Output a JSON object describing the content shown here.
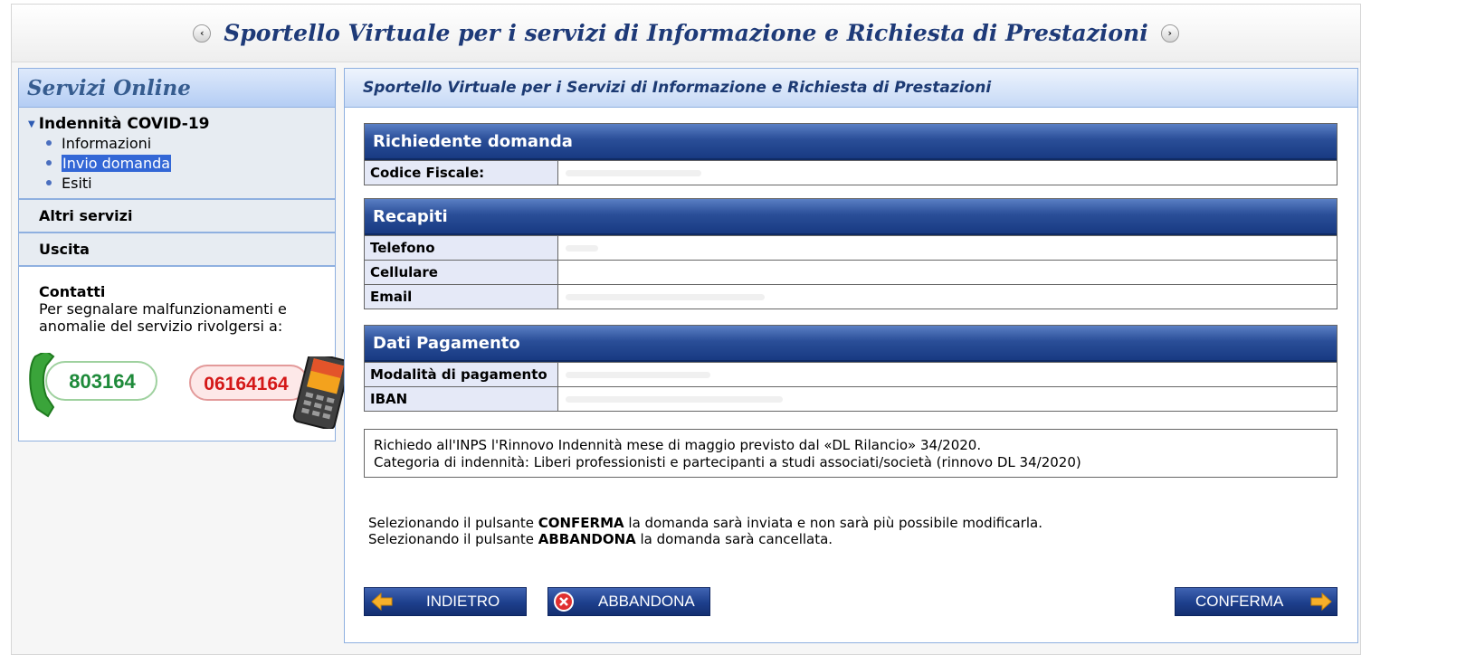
{
  "banner": {
    "title": "Sportello Virtuale per i servizi di Informazione e Richiesta di Prestazioni",
    "prev_glyph": "‹",
    "next_glyph": "›"
  },
  "sidebar": {
    "header": "Servizi Online",
    "group": {
      "title": "Indennità COVID-19",
      "items": [
        {
          "label": "Informazioni"
        },
        {
          "label": "Invio domanda",
          "selected": true
        },
        {
          "label": "Esiti"
        }
      ]
    },
    "other_services": "Altri servizi",
    "exit": "Uscita",
    "contacts": {
      "title": "Contatti",
      "text_line1": "Per segnalare malfunzionamenti e",
      "text_line2": "anomalie del servizio rivolgersi a:",
      "phone_landline": "803164",
      "phone_mobile": "06164164"
    }
  },
  "main": {
    "header": "Sportello Virtuale per i Servizi di Informazione e Richiesta di Prestazioni",
    "applicant": {
      "title": "Richiedente domanda",
      "codice_fiscale_label": "Codice Fiscale:"
    },
    "contacts": {
      "title": "Recapiti",
      "telefono_label": "Telefono",
      "cellulare_label": "Cellulare",
      "email_label": "Email"
    },
    "payment": {
      "title": "Dati Pagamento",
      "modalita_label": "Modalità di pagamento",
      "iban_label": "IBAN"
    },
    "notice_line1": "Richiedo all'INPS l'Rinnovo Indennità mese di maggio previsto dal «DL Rilancio» 34/2020.",
    "notice_line2": "Categoria di indennità: Liberi professionisti e partecipanti a studi associati/società (rinnovo DL 34/2020)",
    "instr1_pre": "Selezionando il pulsante ",
    "instr1_bold": "CONFERMA",
    "instr1_post": " la domanda sarà inviata e non sarà più possibile modificarla.",
    "instr2_pre": "Selezionando il pulsante ",
    "instr2_bold": "ABBANDONA",
    "instr2_post": " la domanda sarà cancellata.",
    "buttons": {
      "back": "INDIETRO",
      "abandon": "ABBANDONA",
      "confirm": "CONFERMA"
    }
  },
  "colors": {
    "header_blue": "#1e3a78",
    "section_blue": "#183a82",
    "selection": "#3367d6"
  }
}
